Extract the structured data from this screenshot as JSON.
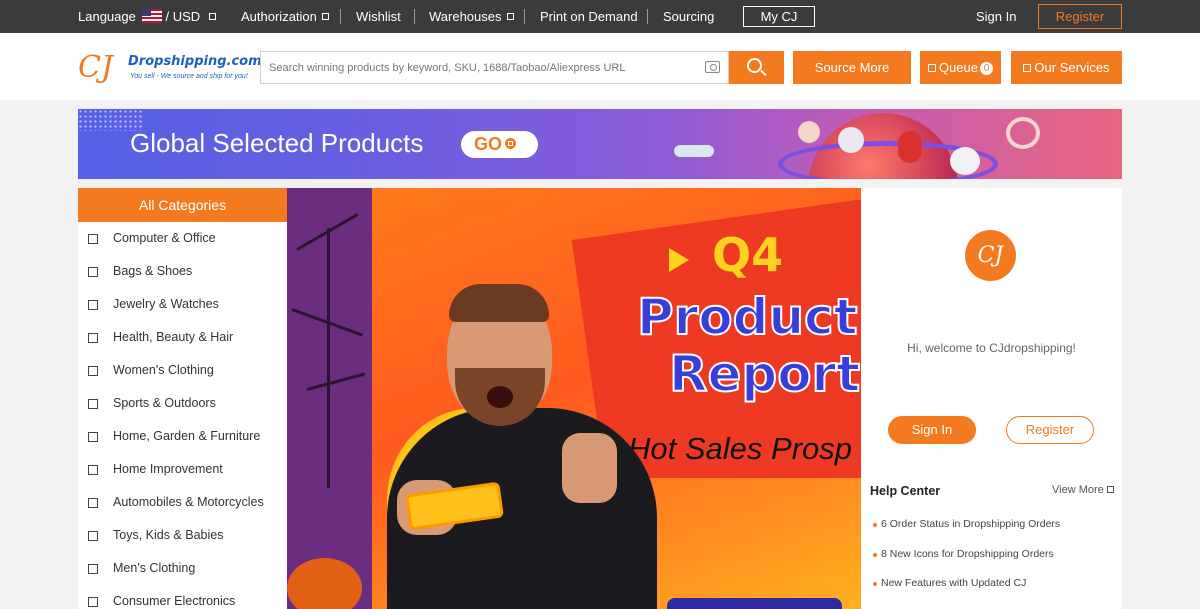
{
  "topbar": {
    "language_label": "Language",
    "currency": "/ USD",
    "authorization": "Authorization",
    "wishlist": "Wishlist",
    "warehouses": "Warehouses",
    "print_on_demand": "Print on Demand",
    "sourcing": "Sourcing",
    "my_cj": "My CJ",
    "sign_in": "Sign In",
    "register": "Register"
  },
  "header": {
    "logo_mark": "CJ",
    "logo_text": "Dropshipping.com",
    "logo_tagline": "You sell - We source and ship for you!",
    "search_placeholder": "Search winning products by keyword, SKU, 1688/Taobao/Aliexpress URL",
    "source_more": "Source More",
    "queue": "Queue",
    "queue_count": "0",
    "our_services": "Our Services"
  },
  "banner": {
    "title": "Global Selected Products",
    "go": "GO"
  },
  "categories": {
    "header": "All Categories",
    "items": [
      {
        "label": "Computer & Office"
      },
      {
        "label": "Bags & Shoes"
      },
      {
        "label": "Jewelry & Watches"
      },
      {
        "label": "Health, Beauty & Hair"
      },
      {
        "label": "Women's Clothing"
      },
      {
        "label": "Sports & Outdoors"
      },
      {
        "label": "Home, Garden & Furniture"
      },
      {
        "label": "Home Improvement"
      },
      {
        "label": "Automobiles & Motorcycles"
      },
      {
        "label": "Toys, Kids & Babies"
      },
      {
        "label": "Men's Clothing"
      },
      {
        "label": "Consumer Electronics"
      }
    ]
  },
  "hero": {
    "q4": "Q4",
    "line1": "Product",
    "line2": "Report",
    "hot_sales": "Hot Sales Prosp"
  },
  "side": {
    "logo": "CJ",
    "welcome": "Hi, welcome to CJdropshipping!",
    "sign_in": "Sign In",
    "register": "Register",
    "help_center": "Help Center",
    "view_more": "View More",
    "news": [
      "6 Order Status in Dropshipping Orders",
      "8 New Icons for Dropshipping Orders",
      "New Features with Updated CJ"
    ]
  },
  "colors": {
    "accent": "#f47a20",
    "topbar": "#3b3b3b",
    "logo_blue": "#1f5fbf"
  }
}
